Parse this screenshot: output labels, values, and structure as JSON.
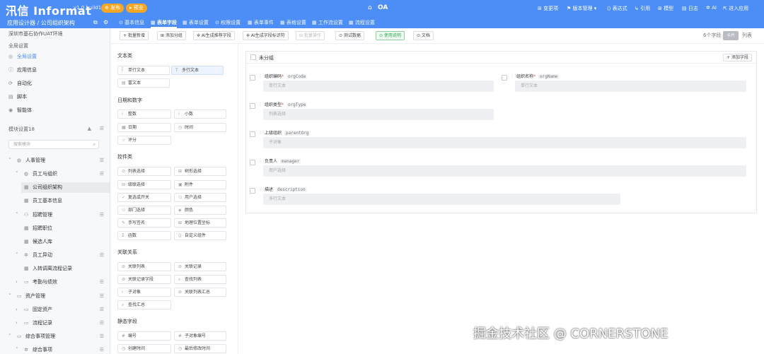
{
  "topbar": {
    "logo": "汛信 Informat",
    "version": "v1.0 build11",
    "publish_label": "⊕ 发布",
    "preview_label": "▸ 预览",
    "app_name": "OA",
    "menus": [
      {
        "label": "⊞ 变更项"
      },
      {
        "label": "⚑ 版本管理 ▾"
      },
      {
        "label": "⟨⟩ 表达式"
      },
      {
        "label": "↳ 引用"
      },
      {
        "label": "⊞ 模型"
      },
      {
        "label": "▤ 日志"
      },
      {
        "label": "✲ AI"
      },
      {
        "label": "⇱ 进入应用"
      }
    ]
  },
  "subbar": {
    "breadcrumb": "应用设计器 / 公司组织架构",
    "tabs": [
      {
        "label": "⊙ 基本信息"
      },
      {
        "label": "▦ 表单字段"
      },
      {
        "label": "▦ 表单设置"
      },
      {
        "label": "⊙ 权限设置"
      },
      {
        "label": "▦ 表单事件"
      },
      {
        "label": "▦ 表格设置"
      },
      {
        "label": "▦ 工作流设置"
      },
      {
        "label": "▦ 流程设置"
      }
    ]
  },
  "sidebar": {
    "subtitle": "深圳市基石协作UAT环境",
    "global_title": "全局设置",
    "global_items": [
      {
        "label": "全局设置"
      },
      {
        "label": "应用信息"
      },
      {
        "label": "自动化"
      },
      {
        "label": "脚本"
      },
      {
        "label": "智能体"
      }
    ],
    "module_title": "模块设置18",
    "search_placeholder": "搜索模块",
    "tree": [
      {
        "label": "人事管理"
      },
      {
        "label": "员工与组织"
      },
      {
        "label": "公司组织架构"
      },
      {
        "label": "员工基本信息"
      },
      {
        "label": "招聘管理"
      },
      {
        "label": "招聘职位"
      },
      {
        "label": "候选人库"
      },
      {
        "label": "员工异动"
      },
      {
        "label": "入转调离流程记录"
      },
      {
        "label": "考勤与绩效"
      },
      {
        "label": "资产管理"
      },
      {
        "label": "固定资产"
      },
      {
        "label": "流程记录"
      },
      {
        "label": "综合事项管理"
      },
      {
        "label": "综合事项"
      }
    ]
  },
  "toolbar": {
    "buttons": [
      {
        "label": "+ 批量新增"
      },
      {
        "label": "⊞ 添加分组"
      },
      {
        "label": "✲ AI生成推荐字段"
      },
      {
        "label": "✲ AI生成字段标识符"
      },
      {
        "label": "⊟ 批量操作"
      },
      {
        "label": "⊙ 测试数据"
      },
      {
        "label": "⊙ 使用说明"
      },
      {
        "label": "⊙ 文档"
      }
    ],
    "field_count": "6个字段",
    "view_card": "卡片",
    "view_list": "列表"
  },
  "palette": {
    "sections": [
      {
        "title": "文本类",
        "items": [
          "单行文本",
          "多行文本",
          "富文本"
        ]
      },
      {
        "title": "日期和数字",
        "items": [
          "整数",
          "小数",
          "日期",
          "时间",
          "评分"
        ]
      },
      {
        "title": "控件类",
        "items": [
          "列表选择",
          "树形选择",
          "级联选择",
          "附件",
          "复选或开关",
          "用户选择",
          "部门选择",
          "颜色",
          "手写签名",
          "地理位置坐标",
          "函数",
          "自定义组件"
        ]
      },
      {
        "title": "关联关系",
        "items": [
          "关联列表",
          "关联记录",
          "关联记录字段",
          "查找列表",
          "子对象",
          "关联列表汇总",
          "查找汇总"
        ]
      },
      {
        "title": "静态字段",
        "items": [
          "编号",
          "子对象编号",
          "创建时间",
          "最后修改时间"
        ]
      }
    ]
  },
  "form": {
    "group_title": "未分组",
    "add_field": "+ 添加字段",
    "fields": [
      {
        "label": "组织编码",
        "required": "*",
        "code": "orgCode",
        "placeholder": "单行文本"
      },
      {
        "label": "组织名称",
        "required": "*",
        "code": "orgName",
        "placeholder": "单行文本"
      },
      {
        "label": "组织类型",
        "required": "*",
        "code": "orgType",
        "placeholder": "列表选择"
      },
      {
        "label": "上级组织",
        "required": "",
        "code": "parentOrg",
        "placeholder": "子对象"
      },
      {
        "label": "负责人",
        "required": "",
        "code": "manager",
        "placeholder": "用户选择"
      },
      {
        "label": "描述",
        "required": "",
        "code": "description",
        "placeholder": "多行文本"
      }
    ]
  },
  "watermark": "掘金技术社区 @ CORNERSTONE"
}
